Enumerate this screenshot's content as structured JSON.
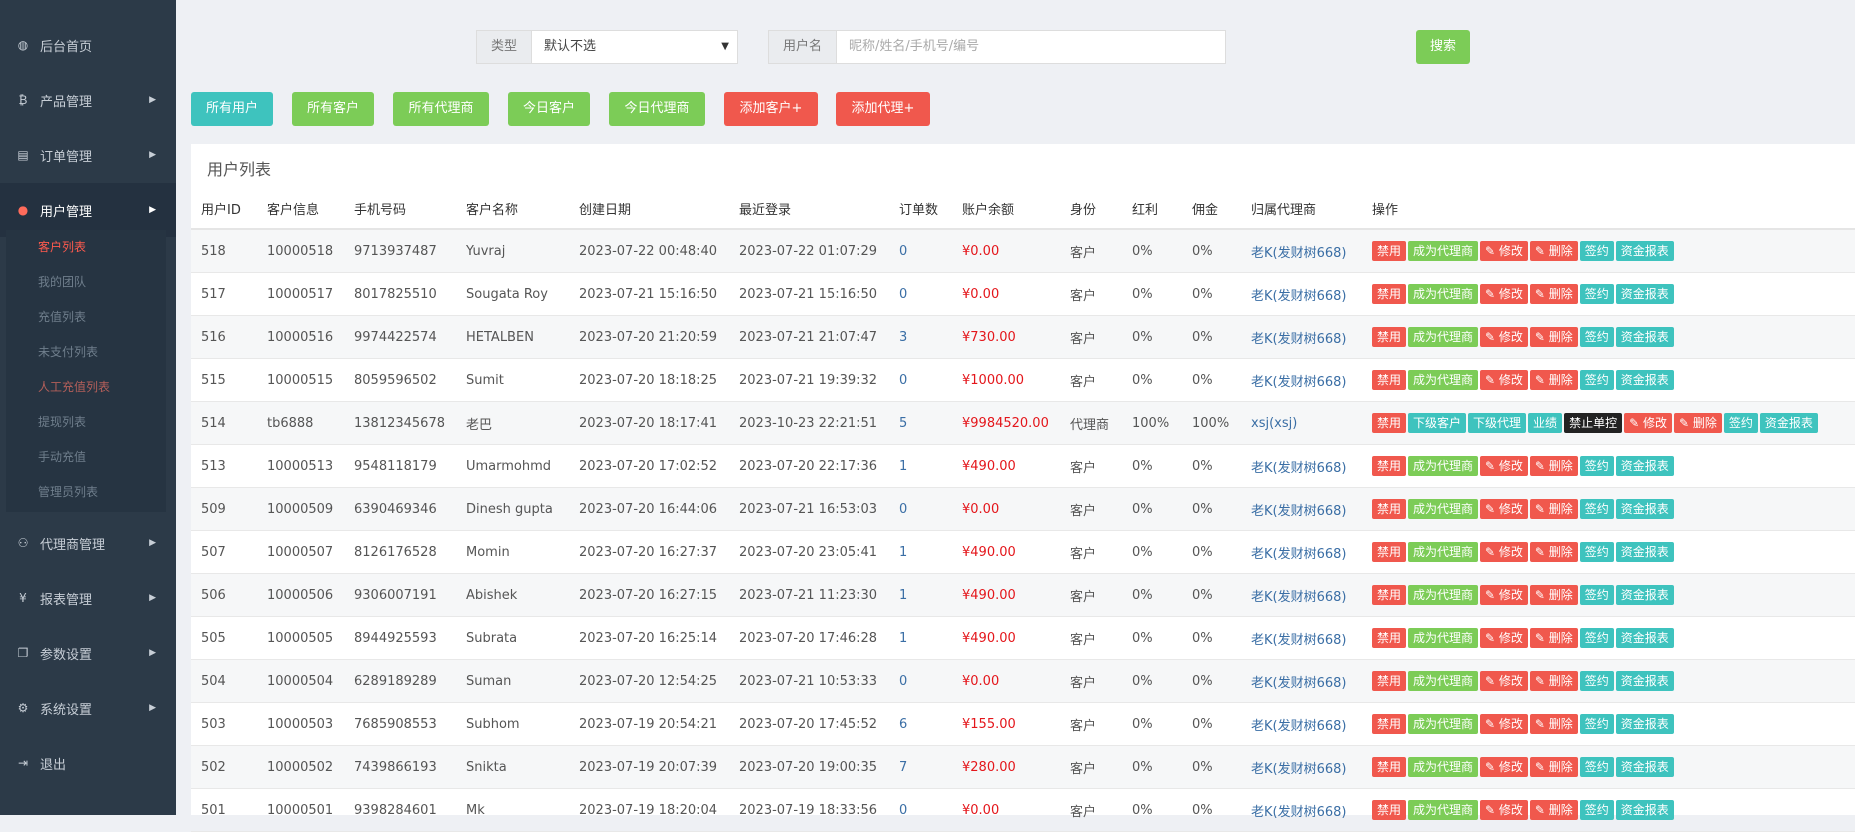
{
  "sidebar": {
    "items": [
      {
        "label": "后台首页",
        "icon": "dashboard-icon"
      },
      {
        "label": "产品管理",
        "icon": "bitcoin-icon"
      },
      {
        "label": "订单管理",
        "icon": "list-icon"
      },
      {
        "label": "用户管理",
        "icon": "user-icon"
      },
      {
        "label": "代理商管理",
        "icon": "sitemap-icon"
      },
      {
        "label": "报表管理",
        "icon": "yen-icon"
      },
      {
        "label": "参数设置",
        "icon": "copy-icon"
      },
      {
        "label": "系统设置",
        "icon": "cogs-icon"
      },
      {
        "label": "退出",
        "icon": "logout-icon"
      }
    ],
    "submenu": [
      "客户列表",
      "我的团队",
      "充值列表",
      "未支付列表",
      "人工充值列表",
      "提现列表",
      "手动充值",
      "管理员列表"
    ]
  },
  "filters": {
    "type_label": "类型",
    "type_value": "默认不选",
    "username_label": "用户名",
    "username_placeholder": "昵称/姓名/手机号/编号",
    "search_label": "搜索"
  },
  "quick_buttons": [
    "所有用户",
    "所有客户",
    "所有代理商",
    "今日客户",
    "今日代理商",
    "添加客户+",
    "添加代理+"
  ],
  "panel_title": "用户列表",
  "table": {
    "headers": [
      "用户ID",
      "客户信息",
      "手机号码",
      "客户名称",
      "创建日期",
      "最近登录",
      "订单数",
      "账户余额",
      "身份",
      "红利",
      "佣金",
      "归属代理商",
      "操作"
    ],
    "customer_actions": [
      "禁用",
      "成为代理商",
      "✎ 修改",
      "✎ 删除",
      "签约",
      "资金报表"
    ],
    "agent_actions": [
      "禁用",
      "下级客户",
      "下级代理",
      "业绩",
      "禁止单控",
      "✎ 修改",
      "✎ 删除",
      "签约",
      "资金报表"
    ],
    "rows": [
      [
        "518",
        "10000518",
        "9713937487",
        "Yuvraj",
        "2023-07-22 00:48:40",
        "2023-07-22 01:07:29",
        "0",
        "¥0.00",
        "客户",
        "0%",
        "0%",
        "老K(发财树668)"
      ],
      [
        "517",
        "10000517",
        "8017825510",
        "Sougata Roy",
        "2023-07-21 15:16:50",
        "2023-07-21 15:16:50",
        "0",
        "¥0.00",
        "客户",
        "0%",
        "0%",
        "老K(发财树668)"
      ],
      [
        "516",
        "10000516",
        "9974422574",
        "HETALBEN",
        "2023-07-20 21:20:59",
        "2023-07-21 21:07:47",
        "3",
        "¥730.00",
        "客户",
        "0%",
        "0%",
        "老K(发财树668)"
      ],
      [
        "515",
        "10000515",
        "8059596502",
        "Sumit",
        "2023-07-20 18:18:25",
        "2023-07-21 19:39:32",
        "0",
        "¥1000.00",
        "客户",
        "0%",
        "0%",
        "老K(发财树668)"
      ],
      [
        "514",
        "tb6888",
        "13812345678",
        "老巴",
        "2023-07-20 18:17:41",
        "2023-10-23 22:21:51",
        "5",
        "¥9984520.00",
        "代理商",
        "100%",
        "100%",
        "xsj(xsj)"
      ],
      [
        "513",
        "10000513",
        "9548118179",
        "Umarmohmd",
        "2023-07-20 17:02:52",
        "2023-07-20 22:17:36",
        "1",
        "¥490.00",
        "客户",
        "0%",
        "0%",
        "老K(发财树668)"
      ],
      [
        "509",
        "10000509",
        "6390469346",
        "Dinesh gupta",
        "2023-07-20 16:44:06",
        "2023-07-21 16:53:03",
        "0",
        "¥0.00",
        "客户",
        "0%",
        "0%",
        "老K(发财树668)"
      ],
      [
        "507",
        "10000507",
        "8126176528",
        "Momin",
        "2023-07-20 16:27:37",
        "2023-07-20 23:05:41",
        "1",
        "¥490.00",
        "客户",
        "0%",
        "0%",
        "老K(发财树668)"
      ],
      [
        "506",
        "10000506",
        "9306007191",
        "Abishek",
        "2023-07-20 16:27:15",
        "2023-07-21 11:23:30",
        "1",
        "¥490.00",
        "客户",
        "0%",
        "0%",
        "老K(发财树668)"
      ],
      [
        "505",
        "10000505",
        "8944925593",
        "Subrata",
        "2023-07-20 16:25:14",
        "2023-07-20 17:46:28",
        "1",
        "¥490.00",
        "客户",
        "0%",
        "0%",
        "老K(发财树668)"
      ],
      [
        "504",
        "10000504",
        "6289189289",
        "Suman",
        "2023-07-20 12:54:25",
        "2023-07-21 10:53:33",
        "0",
        "¥0.00",
        "客户",
        "0%",
        "0%",
        "老K(发财树668)"
      ],
      [
        "503",
        "10000503",
        "7685908553",
        "Subhom",
        "2023-07-19 20:54:21",
        "2023-07-20 17:45:52",
        "6",
        "¥155.00",
        "客户",
        "0%",
        "0%",
        "老K(发财树668)"
      ],
      [
        "502",
        "10000502",
        "7439866193",
        "Snikta",
        "2023-07-19 20:07:39",
        "2023-07-20 19:00:35",
        "7",
        "¥280.00",
        "客户",
        "0%",
        "0%",
        "老K(发财树668)"
      ],
      [
        "501",
        "10000501",
        "9398284601",
        "Mk",
        "2023-07-19 18:20:04",
        "2023-07-19 18:33:56",
        "0",
        "¥0.00",
        "客户",
        "0%",
        "0%",
        "老K(发财树668)"
      ]
    ]
  },
  "colors": {
    "sidebar_bg": "#2c3a48",
    "accent_red": "#f0584d",
    "accent_green": "#7ccc57",
    "accent_teal": "#3ec3be",
    "money_red": "#e4161b",
    "link_blue": "#3a6ea5"
  }
}
